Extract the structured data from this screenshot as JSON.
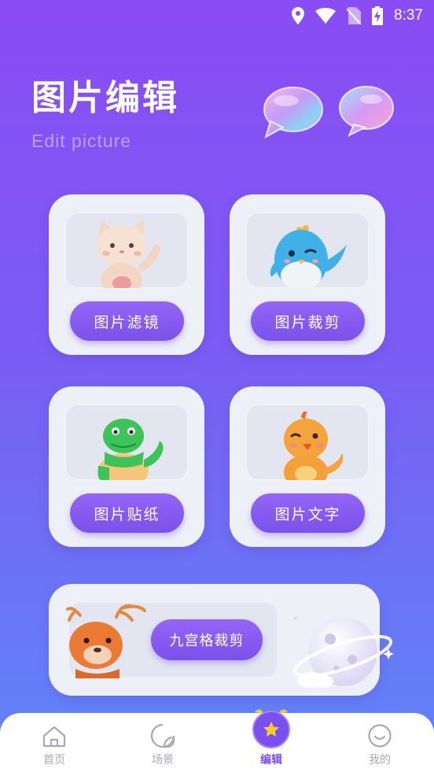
{
  "status_bar": {
    "time": "8:37",
    "icons": [
      "location-icon",
      "wifi-icon",
      "no-sim-icon",
      "battery-charging-icon"
    ]
  },
  "header": {
    "title": "图片编辑",
    "subtitle": "Edit picture"
  },
  "cards": {
    "filter": {
      "label": "图片滤镜",
      "mascot": "cat"
    },
    "crop": {
      "label": "图片裁剪",
      "mascot": "penguin"
    },
    "sticker": {
      "label": "图片贴纸",
      "mascot": "crocodile"
    },
    "text": {
      "label": "图片文字",
      "mascot": "chick"
    },
    "grid_crop": {
      "label": "九宫格裁剪",
      "mascot": "deer"
    }
  },
  "bottom_nav": {
    "items": [
      {
        "label": "首页",
        "icon": "home-icon",
        "active": false
      },
      {
        "label": "场景",
        "icon": "scene-icon",
        "active": false
      },
      {
        "label": "编辑",
        "icon": "edit-star-icon",
        "active": true
      },
      {
        "label": "我的",
        "icon": "smiley-icon",
        "active": false
      }
    ]
  },
  "colors": {
    "bg_top": "#8a4cf3",
    "bg_bottom": "#5f86f8",
    "button": "#8559f0",
    "card": "#eef0f8",
    "active_nav": "#7a4ff0"
  }
}
